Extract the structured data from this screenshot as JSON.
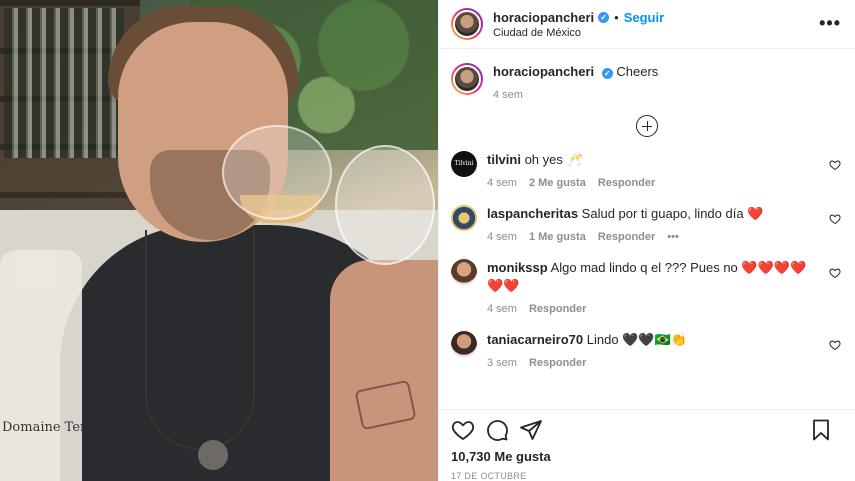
{
  "post": {
    "author": "horaciopancheri",
    "follow_label": "Seguir",
    "location": "Ciudad de México",
    "photo_label": "Domaine Tem"
  },
  "caption": {
    "username": "horaciopancheri",
    "text": "Cheers",
    "time": "4 sem"
  },
  "comments": [
    {
      "username": "tilvini",
      "text": "oh yes 🥂",
      "time": "4 sem",
      "likes": "2 Me gusta",
      "reply": "Responder",
      "avatar_text": "Tilvini"
    },
    {
      "username": "laspancheritas",
      "text": "Salud por ti guapo, lindo día ❤️",
      "time": "4 sem",
      "likes": "1 Me gusta",
      "reply": "Responder"
    },
    {
      "username": "monikssp",
      "text": "Algo mad lindo q el ??? Pues no ❤️❤️❤️❤️❤️❤️",
      "time": "4 sem",
      "reply": "Responder"
    },
    {
      "username": "taniacarneiro70",
      "text": "Lindo 🖤🖤🇧🇷👏",
      "time": "3 sem",
      "reply": "Responder"
    }
  ],
  "footer": {
    "likes": "10,730 Me gusta",
    "date": "17 DE OCTUBRE"
  },
  "icons": {
    "more": "more-options-icon",
    "verified": "verified-badge-icon",
    "load_more": "add-circle-icon",
    "like": "heart-icon",
    "comment": "comment-icon",
    "share": "share-icon",
    "save": "bookmark-icon"
  },
  "colors": {
    "accent": "#0095f6",
    "verified": "#3897f0",
    "text": "#262626",
    "muted": "#8e8e8e"
  }
}
